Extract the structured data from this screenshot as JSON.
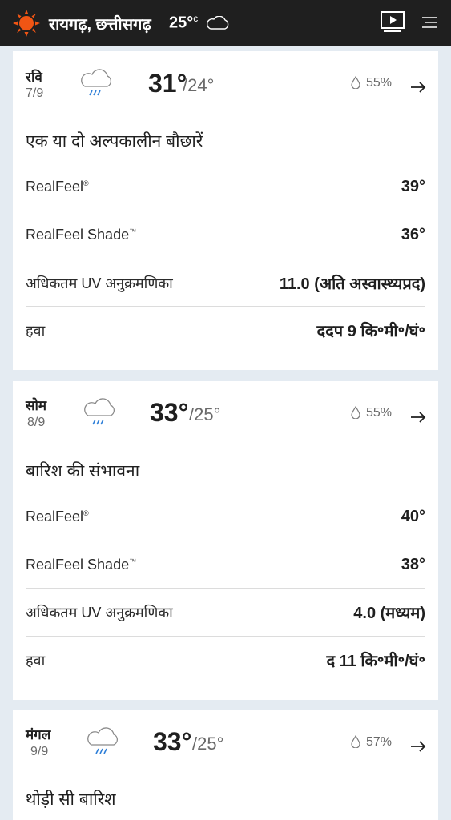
{
  "header": {
    "location": "रायगढ़, छत्तीसगढ़",
    "current_temp": "25°",
    "current_unit": "c",
    "sun_icon": "sun-icon",
    "cloud_icon": "cloudy-icon",
    "video_icon": "play-video-icon",
    "menu_icon": "menu-icon"
  },
  "days": [
    {
      "day": "रवि",
      "date": "7/9",
      "hi": "31°",
      "lo": "/24°",
      "precip": "55%",
      "phrase": "एक या दो अल्पकालीन बौछारें",
      "realfeel_label": "RealFeel",
      "realfeel_mark": "®",
      "realfeel_value": "39°",
      "shade_label": "RealFeel Shade",
      "shade_mark": "™",
      "shade_value": "36°",
      "uv_label": "अधिकतम UV अनुक्रमणिका",
      "uv_value": "11.0 (अति अस्वास्थ्यप्रद)",
      "wind_label": "हवा",
      "wind_value": "ददप 9 कि॰मी॰/घं॰"
    },
    {
      "day": "सोम",
      "date": "8/9",
      "hi": "33°",
      "lo": "/25°",
      "precip": "55%",
      "phrase": "बारिश की संभावना",
      "realfeel_label": "RealFeel",
      "realfeel_mark": "®",
      "realfeel_value": "40°",
      "shade_label": "RealFeel Shade",
      "shade_mark": "™",
      "shade_value": "38°",
      "uv_label": "अधिकतम UV अनुक्रमणिका",
      "uv_value": "4.0 (मध्यम)",
      "wind_label": "हवा",
      "wind_value": "द 11 कि॰मी॰/घं॰"
    },
    {
      "day": "मंगल",
      "date": "9/9",
      "hi": "33°",
      "lo": "/25°",
      "precip": "57%",
      "phrase": "थोड़ी सी बारिश"
    }
  ],
  "colors": {
    "header_bg": "#1f1f1f",
    "sun": "#f05514",
    "page_bg": "#e4ebf2"
  }
}
